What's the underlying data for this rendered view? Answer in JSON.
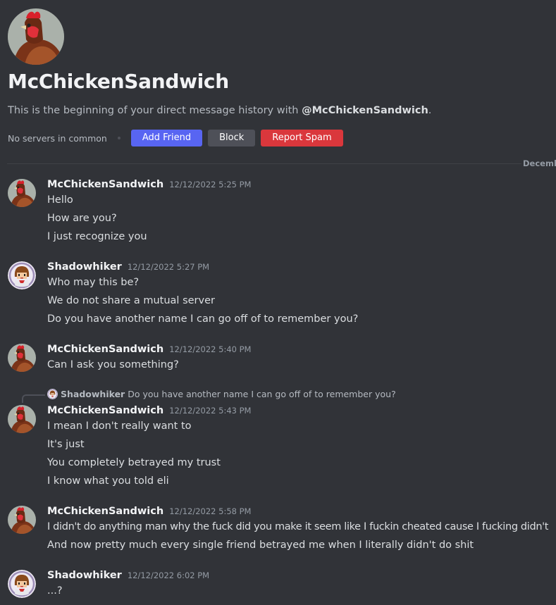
{
  "profile": {
    "name": "McChickenSandwich",
    "intro_prefix": "This is the beginning of your direct message history with ",
    "intro_handle": "@McChickenSandwich",
    "intro_suffix": ".",
    "no_servers": "No servers in common",
    "add_friend": "Add Friend",
    "block": "Block",
    "report_spam": "Report Spam"
  },
  "divider_label": "December",
  "messages": [
    {
      "author": "McChickenSandwich",
      "timestamp": "12/12/2022 5:25 PM",
      "avatar": "rooster-avatar",
      "lines": [
        "Hello",
        "How are you?",
        "I just recognize you"
      ]
    },
    {
      "author": "Shadowhiker",
      "timestamp": "12/12/2022 5:27 PM",
      "avatar": "character-avatar",
      "lines": [
        "Who may this be?",
        "We do not share a mutual server",
        "Do you have another name I can go off of to remember you?"
      ]
    },
    {
      "author": "McChickenSandwich",
      "timestamp": "12/12/2022 5:40 PM",
      "avatar": "rooster-avatar",
      "lines": [
        "Can I ask you something?"
      ]
    },
    {
      "author": "McChickenSandwich",
      "timestamp": "12/12/2022 5:43 PM",
      "avatar": "rooster-avatar",
      "reply": {
        "author": "Shadowhiker",
        "text": "Do you have another name I can go off of to remember you?"
      },
      "lines": [
        "I mean I don't really want to",
        "It's just",
        "You completely betrayed my trust",
        "I know what you told eli"
      ]
    },
    {
      "author": "McChickenSandwich",
      "timestamp": "12/12/2022 5:58 PM",
      "avatar": "rooster-avatar",
      "lines": [
        "I didn't do anything man why the fuck did you make it seem like I fuckin cheated cause I fucking didn't",
        "And now pretty much every single friend betrayed me when I literally didn't do shit"
      ]
    },
    {
      "author": "Shadowhiker",
      "timestamp": "12/12/2022 6:02 PM",
      "avatar": "character-avatar",
      "lines": [
        "...?"
      ]
    }
  ],
  "colors": {
    "blurple": "#5865f2",
    "red": "#da373c",
    "background": "#313338"
  }
}
